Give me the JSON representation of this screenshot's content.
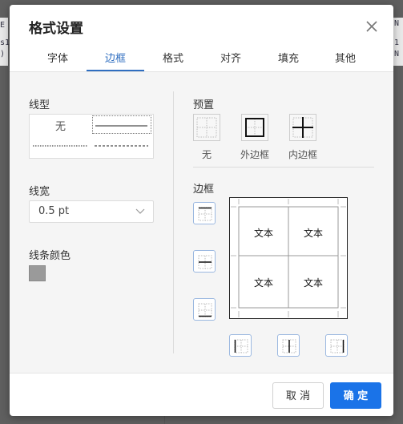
{
  "background": {
    "left_text": [
      "E",
      "s1",
      ")"
    ],
    "right_text": [
      "N",
      "1",
      "N"
    ]
  },
  "dialog": {
    "title": "格式设置",
    "tabs": [
      {
        "label": "字体",
        "active": false
      },
      {
        "label": "边框",
        "active": true
      },
      {
        "label": "格式",
        "active": false
      },
      {
        "label": "对齐",
        "active": false
      },
      {
        "label": "填充",
        "active": false
      },
      {
        "label": "其他",
        "active": false
      }
    ]
  },
  "border_tab": {
    "line_style": {
      "label": "线型",
      "none_label": "无",
      "options": [
        "none",
        "thin-solid",
        "dotted",
        "dashed"
      ]
    },
    "line_width": {
      "label": "线宽",
      "value": "0.5 pt"
    },
    "line_color": {
      "label": "线条颜色",
      "color": "#9a9a9a"
    },
    "presets": {
      "label": "预置",
      "items": [
        {
          "label": "无",
          "icon": "border-none-icon"
        },
        {
          "label": "外边框",
          "icon": "border-outer-icon"
        },
        {
          "label": "内边框",
          "icon": "border-inner-icon"
        }
      ]
    },
    "border": {
      "label": "边框",
      "preview_cells": [
        "文本",
        "文本",
        "文本",
        "文本"
      ]
    }
  },
  "footer": {
    "cancel_label": "取 消",
    "ok_label": "确 定"
  },
  "colors": {
    "accent": "#1a73e8",
    "tab_active": "#2f6ec0",
    "content_bg": "#f5f5f5"
  }
}
